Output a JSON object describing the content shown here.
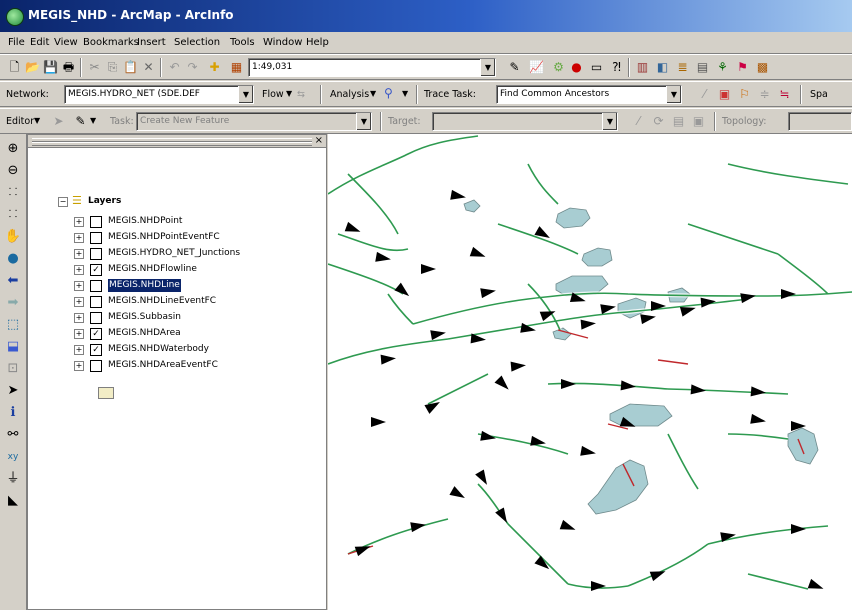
{
  "window": {
    "title": "MEGIS_NHD - ArcMap - ArcInfo"
  },
  "menu": [
    "File",
    "Edit",
    "View",
    "Bookmarks",
    "Insert",
    "Selection",
    "Tools",
    "Window",
    "Help"
  ],
  "standard_toolbar": {
    "scale": "1:49,031"
  },
  "network_toolbar": {
    "network_label": "Network:",
    "network_value": "MEGIS.HYDRO_NET (SDE.DEF",
    "flow_label": "Flow",
    "analysis_label": "Analysis",
    "trace_task_label": "Trace Task:",
    "trace_task_value": "Find Common Ancestors",
    "spa_label": "Spa"
  },
  "editor_toolbar": {
    "editor_label": "Editor",
    "task_label": "Task:",
    "task_value": "Create New Feature",
    "target_label": "Target:",
    "target_value": "",
    "topology_label": "Topology:"
  },
  "toc": {
    "root_label": "Layers",
    "layers": [
      {
        "name": "MEGIS.NHDPoint",
        "checked": false,
        "selected": false
      },
      {
        "name": "MEGIS.NHDPointEventFC",
        "checked": false,
        "selected": false
      },
      {
        "name": "MEGIS.HYDRO_NET_Junctions",
        "checked": false,
        "selected": false
      },
      {
        "name": "MEGIS.NHDFlowline",
        "checked": true,
        "selected": false
      },
      {
        "name": "MEGIS.NHDLine",
        "checked": false,
        "selected": true
      },
      {
        "name": "MEGIS.NHDLineEventFC",
        "checked": false,
        "selected": false
      },
      {
        "name": "MEGIS.Subbasin",
        "checked": false,
        "selected": false
      },
      {
        "name": "MEGIS.NHDArea",
        "checked": true,
        "selected": false
      },
      {
        "name": "MEGIS.NHDWaterbody",
        "checked": true,
        "selected": false
      },
      {
        "name": "MEGIS.NHDAreaEventFC",
        "checked": false,
        "selected": false
      }
    ]
  },
  "colors": {
    "flowline": "#2e9a50",
    "waterbody": "#a8cdd2",
    "arrow": "#000000",
    "red_segment": "#c0282c"
  }
}
